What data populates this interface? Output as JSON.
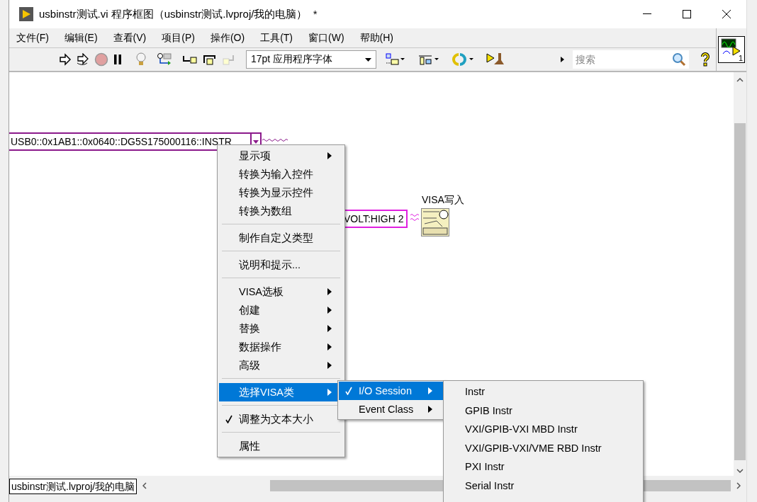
{
  "window": {
    "title": "usbinstr测试.vi 程序框图（usbinstr测试.lvproj/我的电脑）  *"
  },
  "menu": [
    "文件(F)",
    "编辑(E)",
    "查看(V)",
    "项目(P)",
    "操作(O)",
    "工具(T)",
    "窗口(W)",
    "帮助(H)"
  ],
  "toolbar": {
    "font": "17pt 应用程序字体",
    "search": {
      "placeholder": "搜索"
    }
  },
  "connector_pane": {
    "number": "1"
  },
  "diagram": {
    "resource": "USB0::0x1AB1::0x0640::DG5S175000116::INSTR",
    "command": "VOLT:HIGH 2",
    "node_label": "VISA写入"
  },
  "context_menu": {
    "groups": [
      [
        {
          "label": "显示项",
          "submenu": true,
          "checked": false,
          "selected": false
        },
        {
          "label": "转换为输入控件",
          "submenu": false,
          "checked": false,
          "selected": false
        },
        {
          "label": "转换为显示控件",
          "submenu": false,
          "checked": false,
          "selected": false
        },
        {
          "label": "转换为数组",
          "submenu": false,
          "checked": false,
          "selected": false
        }
      ],
      [
        {
          "label": "制作自定义类型",
          "submenu": false,
          "checked": false,
          "selected": false
        }
      ],
      [
        {
          "label": "说明和提示...",
          "submenu": false,
          "checked": false,
          "selected": false
        }
      ],
      [
        {
          "label": "VISA选板",
          "submenu": true,
          "checked": false,
          "selected": false
        },
        {
          "label": "创建",
          "submenu": true,
          "checked": false,
          "selected": false
        },
        {
          "label": "替换",
          "submenu": true,
          "checked": false,
          "selected": false
        },
        {
          "label": "数据操作",
          "submenu": true,
          "checked": false,
          "selected": false
        },
        {
          "label": "高级",
          "submenu": true,
          "checked": false,
          "selected": false
        }
      ],
      [
        {
          "label": "选择VISA类",
          "submenu": true,
          "checked": false,
          "selected": true
        }
      ],
      [
        {
          "label": "调整为文本大小",
          "submenu": false,
          "checked": true,
          "selected": false
        }
      ],
      [
        {
          "label": "属性",
          "submenu": false,
          "checked": false,
          "selected": false
        }
      ]
    ]
  },
  "submenu": {
    "items": [
      {
        "label": "I/O Session",
        "submenu": true,
        "checked": true,
        "selected": true
      },
      {
        "label": "Event Class",
        "submenu": true,
        "checked": false,
        "selected": false
      }
    ]
  },
  "class_menu": {
    "items": [
      "Instr",
      "GPIB Instr",
      "VXI/GPIB-VXI MBD Instr",
      "VXI/GPIB-VXI/VME RBD Instr",
      "PXI Instr",
      "Serial Instr"
    ]
  },
  "status_bar": {
    "context": "usbinstr测试.lvproj/我的电脑"
  }
}
